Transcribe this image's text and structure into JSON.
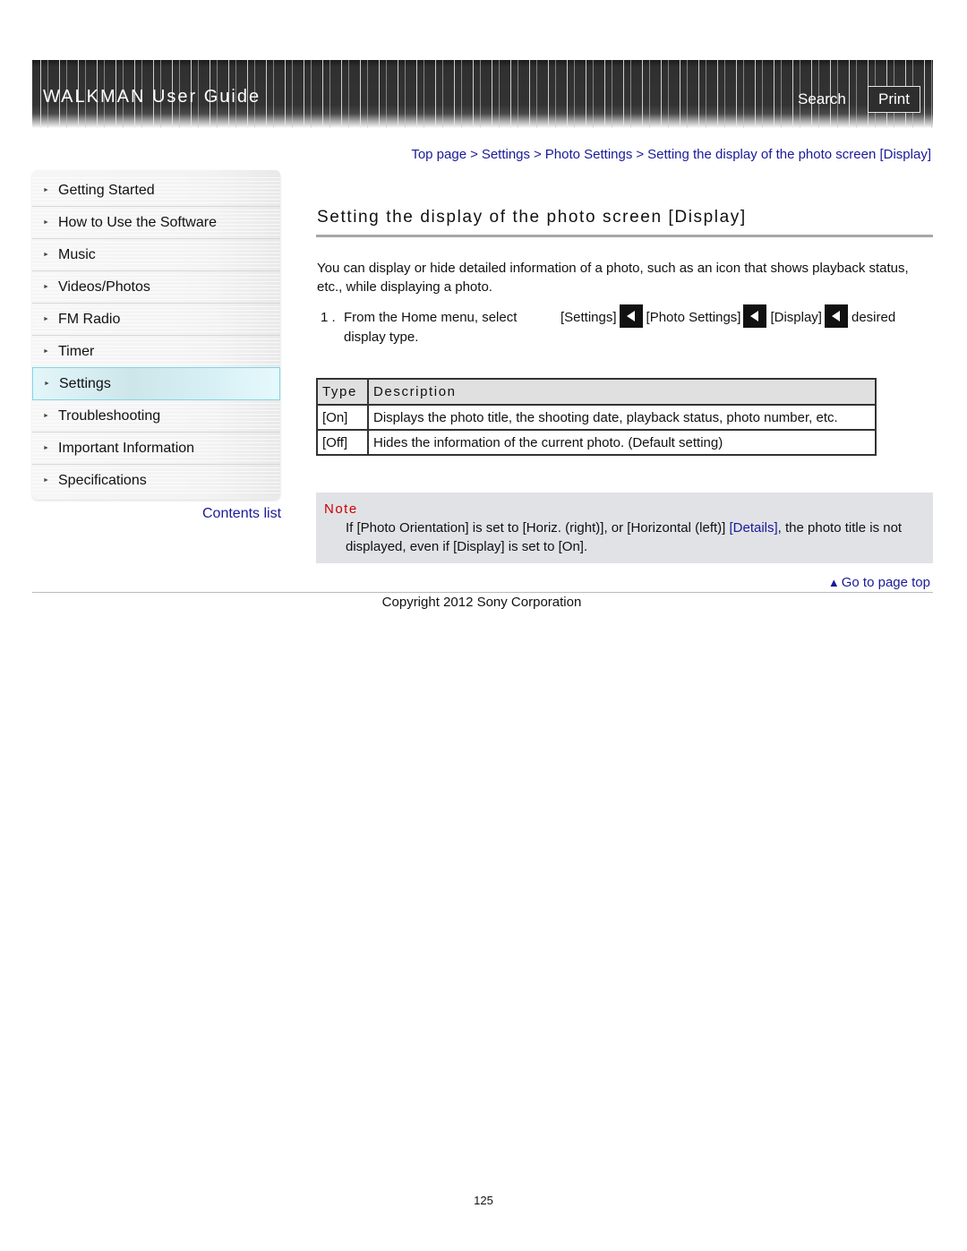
{
  "header": {
    "title": "WALKMAN User Guide",
    "search_label": "Search",
    "print_label": "Print"
  },
  "breadcrumb": {
    "items": [
      "Top page",
      "Settings",
      "Photo Settings",
      "Setting the display of the photo screen [Display]"
    ],
    "separator": ">"
  },
  "sidebar": {
    "items": [
      {
        "label": "Getting Started"
      },
      {
        "label": "How to Use the Software"
      },
      {
        "label": "Music"
      },
      {
        "label": "Videos/Photos"
      },
      {
        "label": "FM Radio"
      },
      {
        "label": "Timer"
      },
      {
        "label": "Settings",
        "active": true
      },
      {
        "label": "Troubleshooting"
      },
      {
        "label": "Important Information"
      },
      {
        "label": "Specifications"
      }
    ],
    "arrow_icon": "►",
    "contents_link": "Contents list"
  },
  "main": {
    "title": "Setting the display of the photo screen [Display]",
    "intro": "You can display or hide detailed information of a photo, such as an icon that shows playback status, etc., while displaying a photo.",
    "step": {
      "number": "1 .",
      "text": "From the Home menu, select",
      "path": [
        "[Settings]",
        "[Photo Settings]",
        "[Display]"
      ],
      "end": "desired",
      "line2": "display type."
    },
    "table": {
      "headers": [
        "Type",
        "Description"
      ],
      "rows": [
        {
          "type": "[On]",
          "description": "Displays the photo title, the shooting date, playback status, photo number, etc."
        },
        {
          "type": "[Off]",
          "description": "Hides the information of the current photo. (Default setting)"
        }
      ]
    },
    "note": {
      "title": "Note",
      "text_before": "If [Photo Orientation] is set to [Horiz. (right)], or [Horizontal (left)] ",
      "link": "[Details]",
      "text_after": ", the photo title is not displayed, even if [Display] is set to [On]."
    }
  },
  "footer": {
    "go_to_top": "Go to page top",
    "go_to_top_icon": "▲",
    "copyright": "Copyright 2012 Sony Corporation",
    "page_number": "125"
  },
  "colors": {
    "link": "#1a1a99",
    "note_title": "#cc0000",
    "note_bg": "#e1e2e6",
    "active_border": "#7fd6ea"
  }
}
